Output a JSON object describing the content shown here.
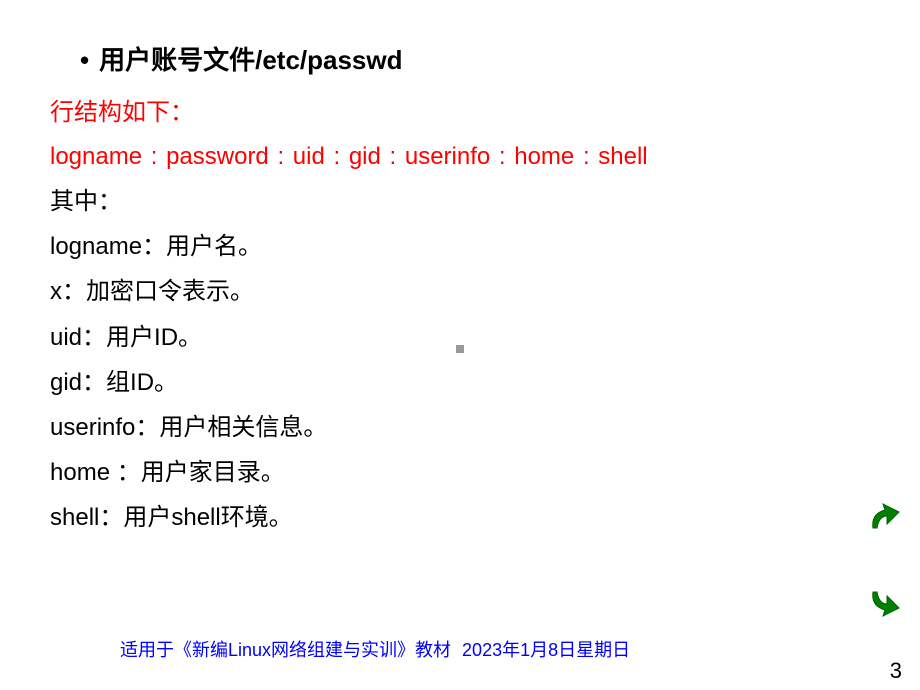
{
  "title": {
    "bullet": "•",
    "text": "用户账号文件/etc/passwd"
  },
  "structure_label": "行结构如下：",
  "structure_line": "logname : password : uid : gid : userinfo : home : shell",
  "where_label": "其中：",
  "fields": [
    "logname：用户名。",
    "x：加密口令表示。",
    "uid：用户ID。",
    "gid：组ID。",
    "userinfo：用户相关信息。",
    "home ：用户家目录。",
    "shell：用户shell环境。"
  ],
  "footer": {
    "book": "适用于《新编Linux网络组建与实训》教材",
    "date": "2023年1月8日星期日"
  },
  "page_number": "3"
}
